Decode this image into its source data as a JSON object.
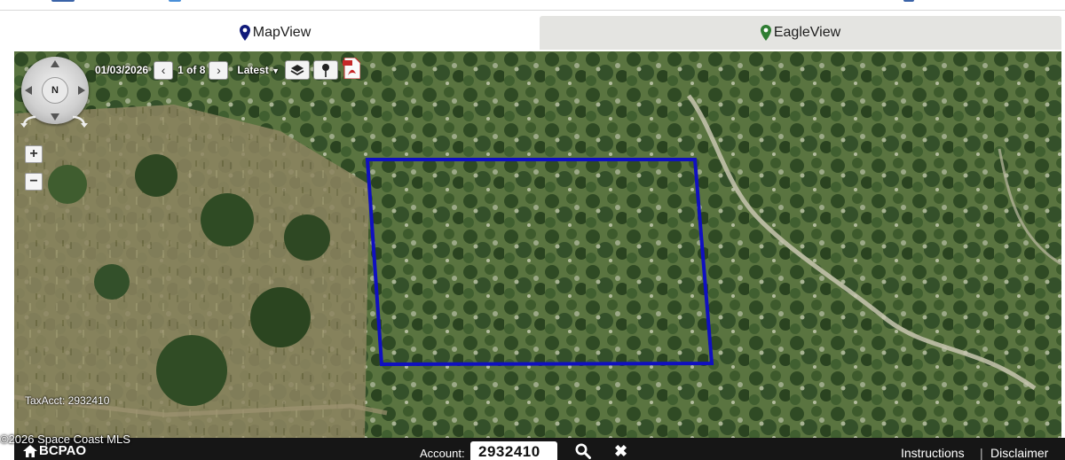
{
  "tabs": [
    {
      "label": "MapView",
      "icon": "map-pin-icon",
      "icon_color": "#101a7a"
    },
    {
      "label": "EagleView",
      "icon": "map-pin-icon",
      "icon_color": "#2e7d32"
    }
  ],
  "viewer": {
    "image_date": "01/03/2026",
    "image_position": "1 of 8",
    "latest_label": "Latest",
    "compass_label": "N",
    "zoom_in_label": "+",
    "zoom_out_label": "−",
    "parcel_label": "TaxAcct: 2932410",
    "parcel_outline_color": "#1010c0",
    "toolbar_icons": [
      "layers-icon",
      "pin-icon",
      "pdf-icon"
    ]
  },
  "bottom_bar": {
    "logo_text": "BCPAO",
    "account_label": "Account:",
    "account_value": "2932410",
    "instructions_label": "Instructions",
    "separator": "|",
    "disclaimer_label": "Disclaimer"
  },
  "watermark": "©2026 Space Coast MLS"
}
